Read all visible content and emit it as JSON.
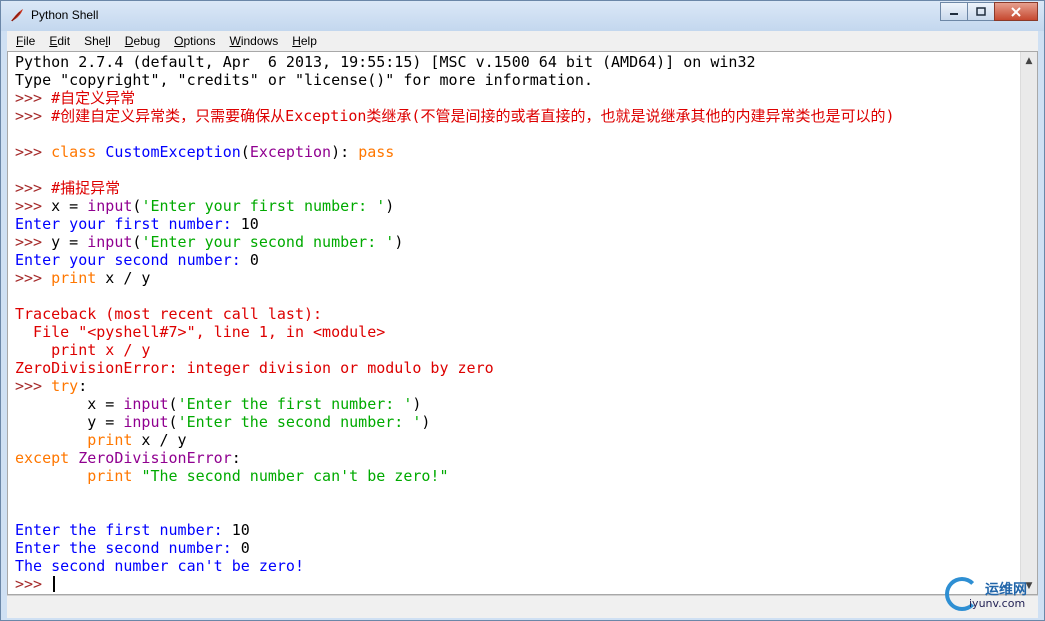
{
  "window": {
    "title": "Python Shell"
  },
  "menu": {
    "items": [
      {
        "u": "F",
        "rest": "ile"
      },
      {
        "u": "E",
        "rest": "dit"
      },
      {
        "pre": "She",
        "u": "l",
        "rest": "l"
      },
      {
        "u": "D",
        "rest": "ebug"
      },
      {
        "u": "O",
        "rest": "ptions"
      },
      {
        "u": "W",
        "rest": "indows"
      },
      {
        "u": "H",
        "rest": "elp"
      }
    ]
  },
  "shell": {
    "lines": [
      [
        [
          "Python 2.7.4 (default, Apr  6 2013, 19:55:15) [MSC v.1500 64 bit (AMD64)] on win32",
          "out"
        ]
      ],
      [
        [
          "Type \"copyright\", \"credits\" or \"license()\" for more information.",
          "out"
        ]
      ],
      [
        [
          ">>> ",
          "prompt"
        ],
        [
          "#自定义异常",
          "com"
        ]
      ],
      [
        [
          ">>> ",
          "prompt"
        ],
        [
          "#创建自定义异常类，只需要确保从Exception类继承(不管是间接的或者直接的，也就是说继承其他的内建异常类也是可以的)",
          "com"
        ]
      ],
      [],
      [
        [
          ">>> ",
          "prompt"
        ],
        [
          "class",
          "kw"
        ],
        [
          " ",
          "out"
        ],
        [
          "CustomException",
          "def"
        ],
        [
          "(",
          "out"
        ],
        [
          "Exception",
          "bi"
        ],
        [
          "): ",
          "out"
        ],
        [
          "pass",
          "kw"
        ]
      ],
      [],
      [
        [
          ">>> ",
          "prompt"
        ],
        [
          "#捕捉异常",
          "com"
        ]
      ],
      [
        [
          ">>> ",
          "prompt"
        ],
        [
          "x = ",
          "out"
        ],
        [
          "input",
          "bi"
        ],
        [
          "(",
          "out"
        ],
        [
          "'Enter your first number: '",
          "str"
        ],
        [
          ")",
          "out"
        ]
      ],
      [
        [
          "Enter your first number: ",
          "stdout"
        ],
        [
          "10",
          "out"
        ]
      ],
      [
        [
          ">>> ",
          "prompt"
        ],
        [
          "y = ",
          "out"
        ],
        [
          "input",
          "bi"
        ],
        [
          "(",
          "out"
        ],
        [
          "'Enter your second number: '",
          "str"
        ],
        [
          ")",
          "out"
        ]
      ],
      [
        [
          "Enter your second number: ",
          "stdout"
        ],
        [
          "0",
          "out"
        ]
      ],
      [
        [
          ">>> ",
          "prompt"
        ],
        [
          "print",
          "kw"
        ],
        [
          " x / y",
          "out"
        ]
      ],
      [],
      [
        [
          "Traceback (most recent call last):",
          "err"
        ]
      ],
      [
        [
          "  File \"<pyshell#7>\", line 1, in <module>",
          "err"
        ]
      ],
      [
        [
          "    print x / y",
          "err"
        ]
      ],
      [
        [
          "ZeroDivisionError: integer division or modulo by zero",
          "err"
        ]
      ],
      [
        [
          ">>> ",
          "prompt"
        ],
        [
          "try",
          "kw"
        ],
        [
          ":",
          "out"
        ]
      ],
      [
        [
          "        x = ",
          "out"
        ],
        [
          "input",
          "bi"
        ],
        [
          "(",
          "out"
        ],
        [
          "'Enter the first number: '",
          "str"
        ],
        [
          ")",
          "out"
        ]
      ],
      [
        [
          "        y = ",
          "out"
        ],
        [
          "input",
          "bi"
        ],
        [
          "(",
          "out"
        ],
        [
          "'Enter the second number: '",
          "str"
        ],
        [
          ")",
          "out"
        ]
      ],
      [
        [
          "        ",
          "out"
        ],
        [
          "print",
          "kw"
        ],
        [
          " x / y",
          "out"
        ]
      ],
      [
        [
          "except",
          "kw"
        ],
        [
          " ",
          "out"
        ],
        [
          "ZeroDivisionError",
          "bi"
        ],
        [
          ":",
          "out"
        ]
      ],
      [
        [
          "        ",
          "out"
        ],
        [
          "print",
          "kw"
        ],
        [
          " ",
          "out"
        ],
        [
          "\"The second number can't be zero!\"",
          "str"
        ]
      ],
      [],
      [],
      [
        [
          "Enter the first number: ",
          "stdout"
        ],
        [
          "10",
          "out"
        ]
      ],
      [
        [
          "Enter the second number: ",
          "stdout"
        ],
        [
          "0",
          "out"
        ]
      ],
      [
        [
          "The second number can't be zero!",
          "stdout"
        ]
      ],
      [
        [
          ">>> ",
          "prompt"
        ]
      ]
    ]
  },
  "watermark": {
    "main": "运维网",
    "sub": "iyunv.com"
  },
  "colors": {
    "prompt": "#a52a2a",
    "comment": "#dd0000",
    "keyword": "#ff7700",
    "definition": "#0000ff",
    "builtin": "#900090",
    "string": "#00aa00",
    "stdout": "#0000ff",
    "error": "#dd0000"
  }
}
